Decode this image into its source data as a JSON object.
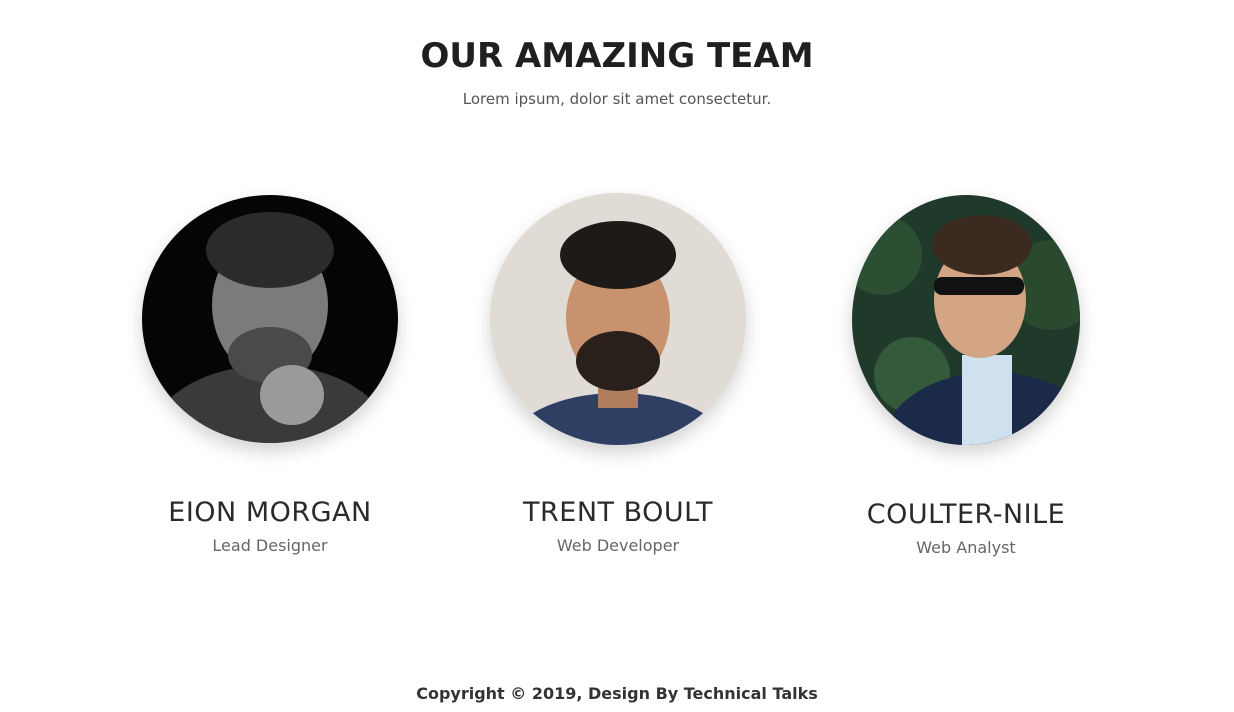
{
  "header": {
    "title": "OUR AMAZING TEAM",
    "subtitle": "Lorem ipsum, dolor sit amet consectetur."
  },
  "team": [
    {
      "name": "EION MORGAN",
      "role": "Lead Designer",
      "photo": "portrait-photo-bw"
    },
    {
      "name": "TRENT BOULT",
      "role": "Web Developer",
      "photo": "portrait-photo-beard"
    },
    {
      "name": "COULTER-NILE",
      "role": "Web Analyst",
      "photo": "portrait-photo-sunglasses"
    }
  ],
  "footer": {
    "copyright": "Copyright © 2019, Design By Technical Talks"
  },
  "colors": {
    "text": "#222222",
    "muted": "#666666",
    "background": "#ffffff"
  }
}
